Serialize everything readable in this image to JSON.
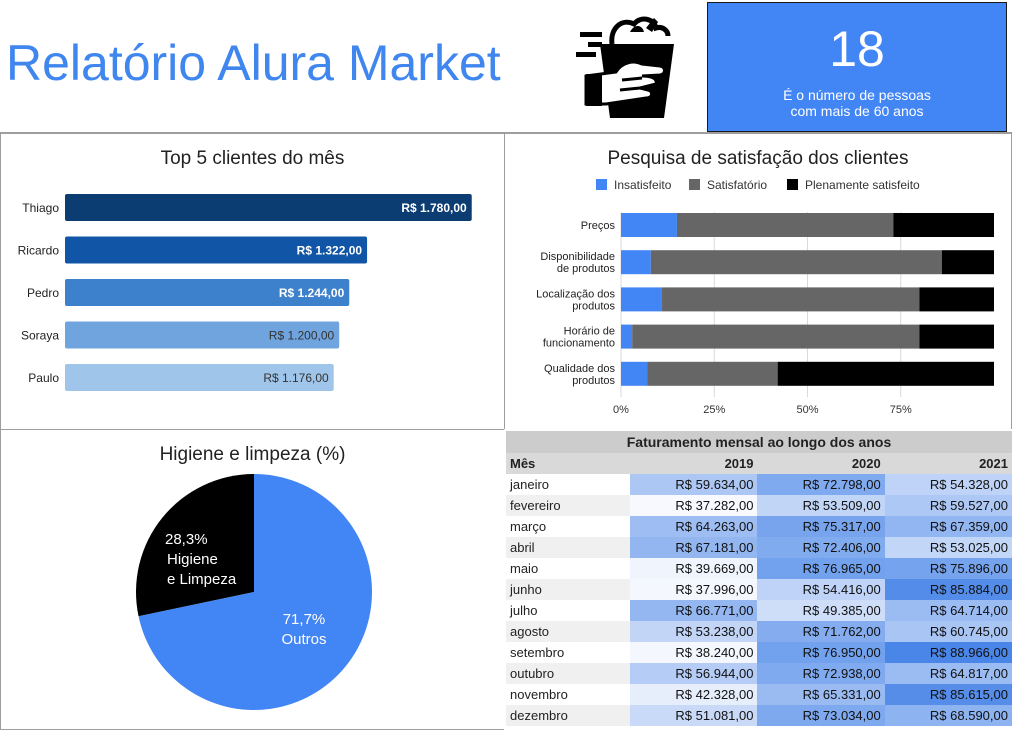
{
  "header": {
    "title": "Relatório Alura Market",
    "kpi_value": "18",
    "kpi_caption": "É o número de pessoas com mais de 60 anos"
  },
  "colors": {
    "accent": "#4285f4",
    "title_blue": "#3f86ee",
    "bar_shades": [
      "#0b3d73",
      "#1155a6",
      "#3d80cc",
      "#6fa4de",
      "#9fc5ea"
    ],
    "survey": [
      "#4285f4",
      "#666666",
      "#000000"
    ],
    "pie": [
      "#000000",
      "#4285f4"
    ]
  },
  "chart_data": [
    {
      "type": "bar",
      "orientation": "horizontal",
      "title": "Top 5 clientes do mês",
      "categories": [
        "Thiago",
        "Ricardo",
        "Pedro",
        "Soraya",
        "Paulo"
      ],
      "values": [
        1780.0,
        1322.0,
        1244.0,
        1200.0,
        1176.0
      ],
      "data_labels": [
        "R$ 1.780,00",
        "R$ 1.322,00",
        "R$ 1.244,00",
        "R$ 1.200,00",
        "R$ 1.176,00"
      ],
      "xlim": [
        0,
        2000
      ],
      "grid": false,
      "legend": "none"
    },
    {
      "type": "bar",
      "orientation": "horizontal",
      "stacked": "percent",
      "title": "Pesquisa de satisfação dos clientes",
      "categories": [
        "Preços",
        "Disponibilidade de produtos",
        "Localização dos produtos",
        "Horário de funcionamento",
        "Qualidade dos produtos"
      ],
      "category_lines": [
        [
          "Preços"
        ],
        [
          "Disponibilidade",
          "de produtos"
        ],
        [
          "Localização dos",
          "produtos"
        ],
        [
          "Horário de",
          "funcionamento"
        ],
        [
          "Qualidade dos",
          "produtos"
        ]
      ],
      "series": [
        {
          "name": "Insatisfeito",
          "values": [
            15,
            8,
            11,
            3,
            7
          ]
        },
        {
          "name": "Satisfatório",
          "values": [
            58,
            78,
            69,
            77,
            35
          ]
        },
        {
          "name": "Plenamente satisfeito",
          "values": [
            27,
            14,
            20,
            20,
            58
          ]
        }
      ],
      "xlim": [
        0,
        100
      ],
      "xticks": [
        "0%",
        "25%",
        "50%",
        "75%"
      ],
      "grid": true,
      "legend": "top"
    },
    {
      "type": "pie",
      "title": "Higiene e limpeza (%)",
      "slices": [
        {
          "label": "Higiene e Limpeza",
          "label_lines": [
            "28,3%",
            "Higiene",
            "e Limpeza"
          ],
          "value": 28.3
        },
        {
          "label": "Outros",
          "label_lines": [
            "71,7%",
            "Outros"
          ],
          "value": 71.7
        }
      ],
      "legend": "none"
    },
    {
      "type": "table",
      "title": "Faturamento mensal ao longo dos anos",
      "columns": [
        "Mês",
        "2019",
        "2020",
        "2021"
      ],
      "rows": [
        [
          "janeiro",
          "R$ 59.634,00",
          "R$ 72.798,00",
          "R$ 54.328,00"
        ],
        [
          "fevereiro",
          "R$ 37.282,00",
          "R$ 53.509,00",
          "R$ 59.527,00"
        ],
        [
          "março",
          "R$ 64.263,00",
          "R$ 75.317,00",
          "R$ 67.359,00"
        ],
        [
          "abril",
          "R$ 67.181,00",
          "R$ 72.406,00",
          "R$ 53.025,00"
        ],
        [
          "maio",
          "R$ 39.669,00",
          "R$ 76.965,00",
          "R$ 75.896,00"
        ],
        [
          "junho",
          "R$ 37.996,00",
          "R$ 54.416,00",
          "R$ 85.884,00"
        ],
        [
          "julho",
          "R$ 66.771,00",
          "R$ 49.385,00",
          "R$ 64.714,00"
        ],
        [
          "agosto",
          "R$ 53.238,00",
          "R$ 71.762,00",
          "R$ 60.745,00"
        ],
        [
          "setembro",
          "R$ 38.240,00",
          "R$ 76.950,00",
          "R$ 88.966,00"
        ],
        [
          "outubro",
          "R$ 56.944,00",
          "R$ 72.938,00",
          "R$ 64.817,00"
        ],
        [
          "novembro",
          "R$ 42.328,00",
          "R$ 65.331,00",
          "R$ 85.615,00"
        ],
        [
          "dezembro",
          "R$ 51.081,00",
          "R$ 73.034,00",
          "R$ 68.590,00"
        ]
      ],
      "values": [
        [
          59634,
          72798,
          54328
        ],
        [
          37282,
          53509,
          59527
        ],
        [
          64263,
          75317,
          67359
        ],
        [
          67181,
          72406,
          53025
        ],
        [
          39669,
          76965,
          75896
        ],
        [
          37996,
          54416,
          85884
        ],
        [
          66771,
          49385,
          64714
        ],
        [
          53238,
          71762,
          60745
        ],
        [
          38240,
          76950,
          88966
        ],
        [
          56944,
          72938,
          64817
        ],
        [
          42328,
          65331,
          85615
        ],
        [
          51081,
          73034,
          68590
        ]
      ],
      "heatmap_colors": [
        "#f7f9fe",
        "#4a86e8"
      ]
    }
  ]
}
